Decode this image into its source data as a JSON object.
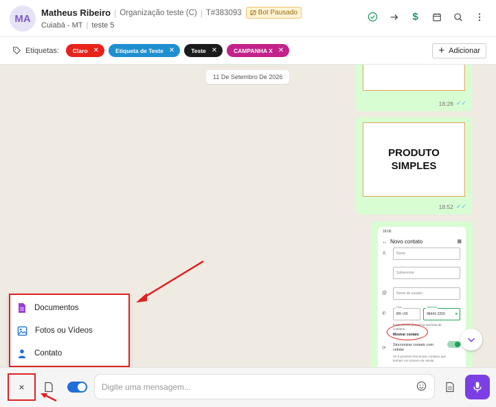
{
  "header": {
    "avatar_initials": "MA",
    "contact_name": "Matheus Ribeiro",
    "organization": "Organização teste (C)",
    "ticket": "T#383093",
    "bot_status": "Bot Pausado",
    "location": "Cuiabá - MT",
    "queue": "teste 5",
    "icons": [
      "check-circle-icon",
      "arrow-right-icon",
      "dollar-icon",
      "calendar-icon",
      "search-icon",
      "more-vertical-icon"
    ]
  },
  "tags": {
    "label": "Etiquetas:",
    "items": [
      {
        "label": "Claro",
        "color": "#e8231c"
      },
      {
        "label": "Etiqueta de Teste",
        "color": "#1f8fd0"
      },
      {
        "label": "Teste",
        "color": "#1b1b1b"
      },
      {
        "label": "CAMPANHA X",
        "color": "#c4228a"
      }
    ],
    "add_label": "Adicionar"
  },
  "chat": {
    "date": "11 De Setembro De 2026",
    "messages": [
      {
        "time": "18:28"
      },
      {
        "image_text": "PRODUTO\nSIMPLES",
        "time": "18:52"
      }
    ],
    "phone_screenshot": {
      "status_time": "18:06",
      "title": "Novo contato",
      "fields": [
        "Nome",
        "Sobrenome",
        "Nome de usuário"
      ],
      "country_label": "País",
      "country_value": "BR +55",
      "phone_label": "Telefone",
      "phone_value": "98441-2203",
      "note": "Essa pessoa já está na sua lista de contatos.",
      "show_contact": "Mostrar contato",
      "sync_label": "Sincronizar contato com celular",
      "sync_note": "Se é possível sincronizar contatos que tenham um número de celular"
    }
  },
  "attach_menu": {
    "items": [
      {
        "label": "Documentos",
        "icon": "document-icon"
      },
      {
        "label": "Fotos ou Vídeos",
        "icon": "image-icon"
      },
      {
        "label": "Contato",
        "icon": "person-icon"
      }
    ]
  },
  "composer": {
    "placeholder": "Digite uma mensagem...",
    "close_symbol": "×",
    "accent": "#7b3fe4",
    "toggle_on": true
  }
}
